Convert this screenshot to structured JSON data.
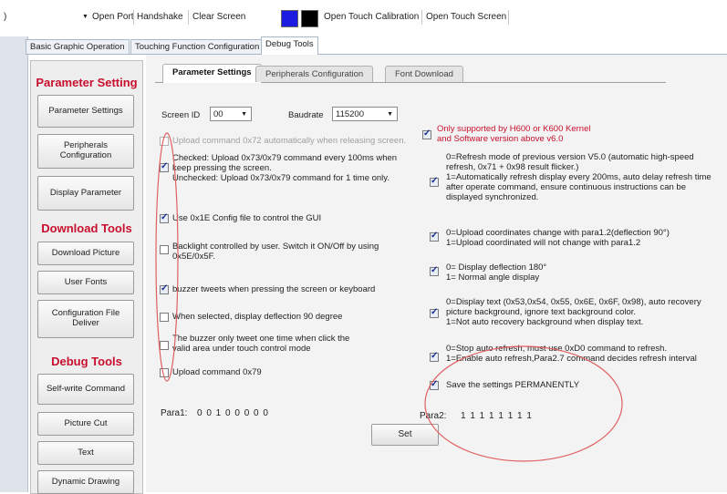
{
  "toolbar": {
    "open_port": "Open Port",
    "handshake": "Handshake",
    "clear_screen": "Clear Screen",
    "color1": "#1c1ce0",
    "color2": "#000000",
    "open_touch_calibration": "Open Touch Calibration",
    "open_touch_screen": "Open Touch Screen"
  },
  "main_tabs": [
    "Basic Graphic Operation",
    "Touching Function Configuration",
    "Debug Tools"
  ],
  "sidebar": {
    "parameter_setting_head": "Parameter Setting",
    "parameter_settings_btn": "Parameter Settings",
    "peripherals_btn": "Peripherals Configuration",
    "display_parameter_btn": "Display Parameter",
    "download_tools_head": "Download Tools",
    "download_picture_btn": "Download Picture",
    "user_fonts_btn": "User Fonts",
    "config_file_btn": "Configuration File Deliver",
    "debug_tools_head": "Debug Tools",
    "self_write_btn": "Self-write Command",
    "picture_cut_btn": "Picture Cut",
    "text_btn": "Text",
    "dynamic_drawing_btn": "Dynamic Drawing"
  },
  "sub_tabs": [
    "Parameter Settings",
    "Peripherals Configuration",
    "Font Download"
  ],
  "form": {
    "screen_id_label": "Screen ID",
    "screen_id_value": "00",
    "baudrate_label": "Baudrate",
    "baudrate_value": "115200"
  },
  "left_options": [
    {
      "checked": false,
      "disabled": true,
      "text": "Upload command 0x72 automatically when releasing screen."
    },
    {
      "checked": true,
      "disabled": false,
      "text": "Checked: Upload 0x73/0x79 command every 100ms when keep pressing the screen.\nUnchecked: Upload 0x73/0x79 command for 1 time only."
    },
    {
      "checked": true,
      "disabled": false,
      "text": "Use 0x1E Config file to control the GUI"
    },
    {
      "checked": false,
      "disabled": false,
      "text": "Backlight controlled by user. Switch it ON/Off by using 0x5E/0x5F."
    },
    {
      "checked": true,
      "disabled": false,
      "text": "buzzer tweets when pressing the screen or keyboard"
    },
    {
      "checked": false,
      "disabled": false,
      "text": "When selected, display deflection 90 degree"
    },
    {
      "checked": false,
      "disabled": false,
      "text": "The buzzer only tweet one time when click the valid area under touch control mode"
    },
    {
      "checked": false,
      "disabled": false,
      "text": "Upload command 0x79"
    }
  ],
  "right_options": [
    {
      "checked": true,
      "red": true,
      "text": "Only supported by H600 or K600 Kernel\nand Software version above v6.0"
    },
    {
      "checked": true,
      "red": false,
      "text": "0=Refresh mode of previous version V5.0 (automatic high-speed refresh, 0x71 + 0x98 result flicker.)\n1=Automatically refresh display every 200ms, auto delay refresh time after operate command, ensure continuous instructions can be displayed synchronized."
    },
    {
      "checked": true,
      "red": false,
      "text": "0=Upload coordinates change with para1.2(deflection 90°)\n1=Upload coordinated will not change with para1.2"
    },
    {
      "checked": true,
      "red": false,
      "text": "0= Display deflection 180°\n1= Normal angle display"
    },
    {
      "checked": true,
      "red": false,
      "text": "0=Display text (0x53,0x54, 0x55, 0x6E, 0x6F, 0x98), auto recovery picture background, ignore text background color.\n1=Not auto recovery background when display text."
    },
    {
      "checked": true,
      "red": false,
      "text": "0=Stop auto refresh, must use 0xD0 command to refresh.\n1=Enable auto refresh,Para2.7 command decides refresh interval"
    },
    {
      "checked": true,
      "red": false,
      "text": "Save the settings PERMANENTLY"
    }
  ],
  "para1_label": "Para1:",
  "para1_value": "0 0 1 0 0 0 0 0",
  "para2_label": "Para2:",
  "para2_value": "1 1 1 1 1 1 1 1",
  "set_button": "Set",
  "annotation_color": "#e06060"
}
